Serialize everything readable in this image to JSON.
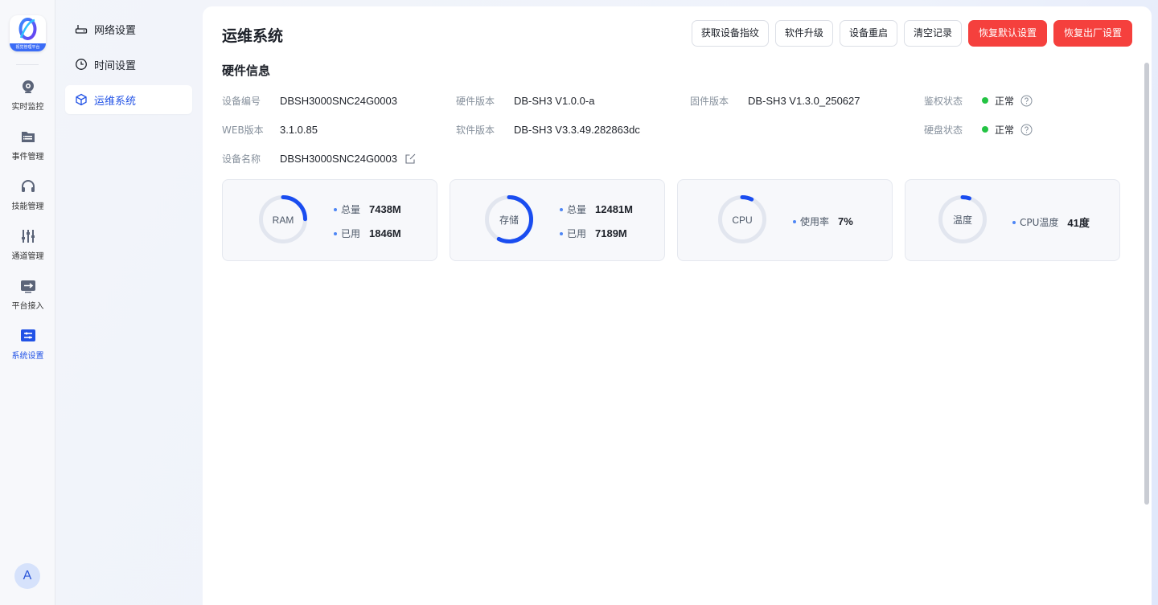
{
  "app": {
    "logo_caption": "视觉管理平台"
  },
  "rail": {
    "items": [
      {
        "label": "实时监控",
        "icon": "monitor-camera-icon"
      },
      {
        "label": "事件管理",
        "icon": "event-list-icon"
      },
      {
        "label": "技能管理",
        "icon": "headset-icon"
      },
      {
        "label": "通道管理",
        "icon": "sliders-icon"
      },
      {
        "label": "平台接入",
        "icon": "platform-access-icon"
      },
      {
        "label": "系统设置",
        "icon": "system-settings-icon",
        "active": true
      }
    ],
    "avatar_letter": "A"
  },
  "submenu": {
    "items": [
      {
        "label": "网络设置",
        "icon": "router-icon"
      },
      {
        "label": "时间设置",
        "icon": "clock-icon"
      },
      {
        "label": "运维系统",
        "icon": "cube-icon",
        "active": true
      }
    ]
  },
  "main": {
    "title": "运维系统",
    "toolbar": {
      "fingerprint": "获取设备指纹",
      "upgrade": "软件升级",
      "reboot": "设备重启",
      "clear": "清空记录",
      "restore_default": "恢复默认设置",
      "factory_reset": "恢复出厂设置"
    },
    "section_title": "硬件信息",
    "info": {
      "device_no": {
        "label": "设备编号",
        "value": "DBSH3000SNC24G0003"
      },
      "hw_version": {
        "label": "硬件版本",
        "value": "DB-SH3 V1.0.0-a"
      },
      "fw_version": {
        "label": "固件版本",
        "value": "DB-SH3 V1.3.0_250627"
      },
      "auth_status": {
        "label": "鉴权状态",
        "value": "正常"
      },
      "web_version": {
        "label": "WEB版本",
        "value": "3.1.0.85"
      },
      "sw_version": {
        "label": "软件版本",
        "value": "DB-SH3 V3.3.49.282863dc"
      },
      "disk_status": {
        "label": "硬盘状态",
        "value": "正常"
      },
      "device_name": {
        "label": "设备名称",
        "value": "DBSH3000SNC24G0003"
      }
    },
    "stats": {
      "ram": {
        "label": "RAM",
        "total_label": "总量",
        "total": "7438M",
        "used_label": "已用",
        "used": "1846M",
        "fraction": 0.248
      },
      "storage": {
        "label": "存储",
        "total_label": "总量",
        "total": "12481M",
        "used_label": "已用",
        "used": "7189M",
        "fraction": 0.576
      },
      "cpu": {
        "label": "CPU",
        "usage_label": "使用率",
        "usage": "7%",
        "fraction": 0.07
      },
      "temp": {
        "label": "温度",
        "temp_label": "CPU温度",
        "temp": "41度",
        "fraction": 0.05
      }
    }
  },
  "colors": {
    "accent": "#2152e6",
    "gauge_fill": "#1a4df0",
    "gauge_track": "#e2e6ef",
    "danger": "#f5403d",
    "ok": "#23c343"
  }
}
